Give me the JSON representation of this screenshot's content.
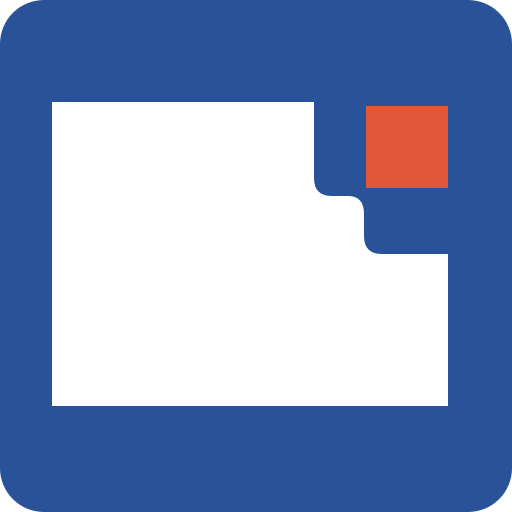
{
  "app_icon": {
    "icon": "window-with-notification-icon",
    "colors": {
      "background": "#2A5298",
      "window": "#FFFFFF",
      "badge": "#E0573A"
    }
  }
}
